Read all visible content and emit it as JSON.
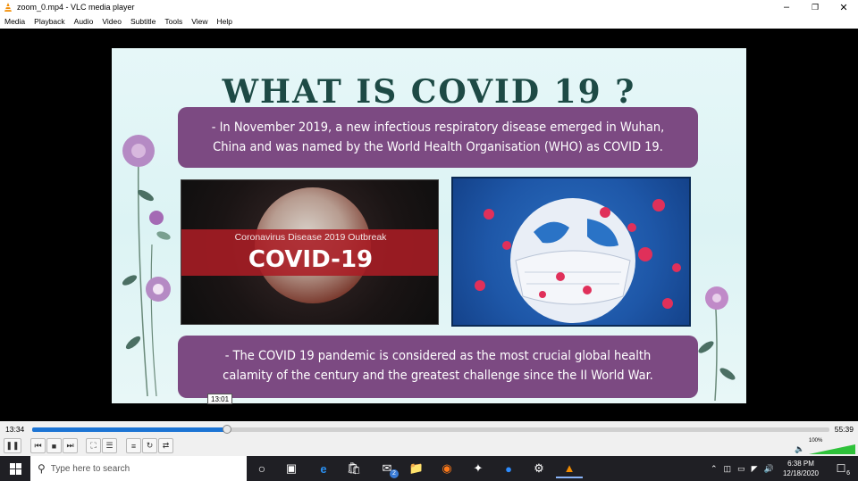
{
  "window": {
    "title": "zoom_0.mp4 - VLC media player",
    "minimize_icon": "minimize-icon",
    "restore_icon": "restore-icon",
    "close_icon": "close-icon"
  },
  "menu": [
    "Media",
    "Playback",
    "Audio",
    "Video",
    "Subtitle",
    "Tools",
    "View",
    "Help"
  ],
  "slide": {
    "title": "WHAT IS COVID 19 ?",
    "top_text": [
      "- In November 2019, a new infectious respiratory disease emerged in Wuhan,",
      "China and was named by the World Health Organisation (WHO) as COVID 19."
    ],
    "image_left": {
      "subtitle": "Coronavirus Disease 2019 Outbreak",
      "headline": "COVID-19"
    },
    "bottom_text": [
      "- The COVID 19 pandemic is considered as the most crucial global health",
      "calamity of the century and the greatest challenge since the II World War."
    ]
  },
  "player": {
    "current_time": "13:34",
    "total_time": "55:39",
    "hover_time": "13:01",
    "progress_fraction": 0.244,
    "volume": "100%",
    "accent_color": "#1c74d4",
    "volume_color": "#2ec23a"
  },
  "taskbar": {
    "search_placeholder": "Type here to search",
    "mail_badge": "2",
    "time": "6:38 PM",
    "date": "12/18/2020",
    "notification_count": "6"
  }
}
